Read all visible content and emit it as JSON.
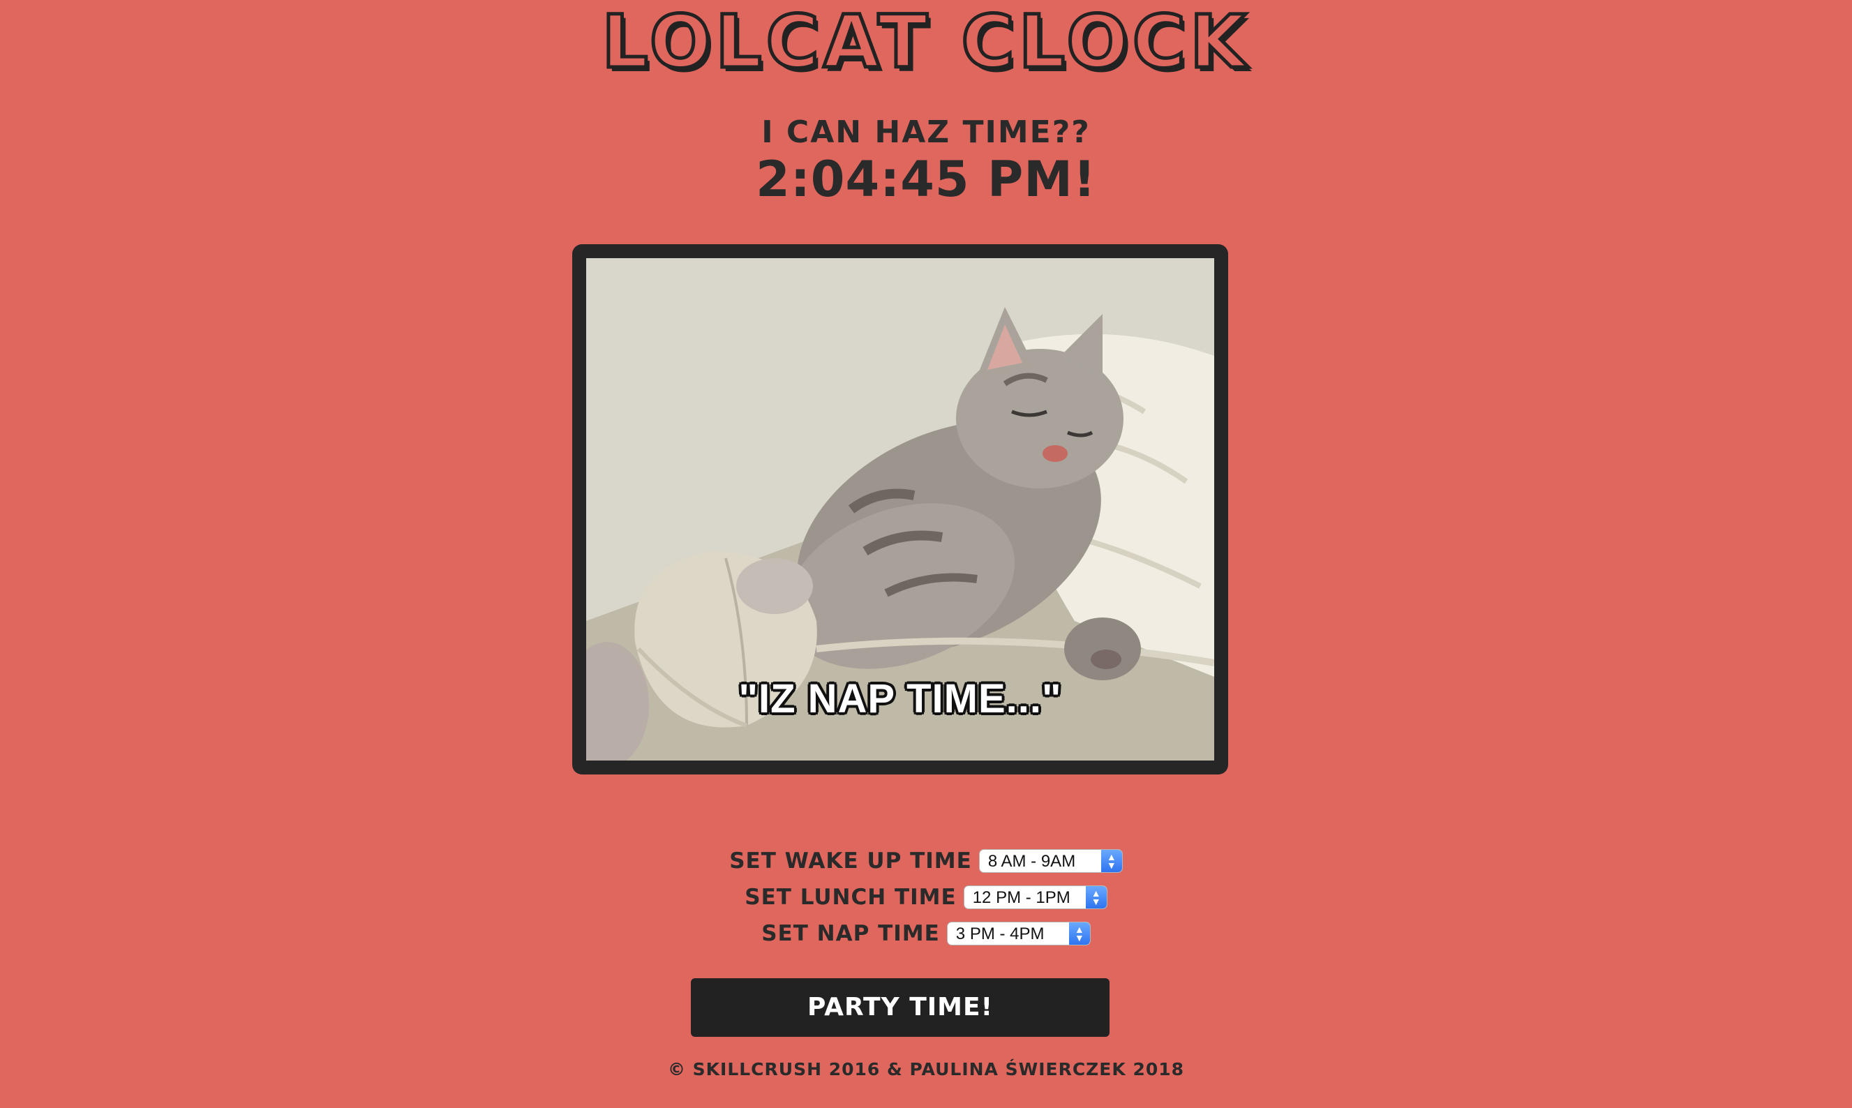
{
  "header": {
    "title": "LOLCAT CLOCK",
    "subtitle": "I CAN HAZ TIME??",
    "time": "2:04:45 PM!"
  },
  "image": {
    "caption": "\"IZ NAP TIME...\"",
    "subject": "sleeping-kitten-with-computer-mouse"
  },
  "controls": {
    "wake": {
      "label": "SET WAKE UP TIME",
      "value": "8 AM - 9AM"
    },
    "lunch": {
      "label": "SET LUNCH TIME",
      "value": "12 PM - 1PM"
    },
    "nap": {
      "label": "SET NAP TIME",
      "value": "3 PM - 4PM"
    }
  },
  "party_button": {
    "label": "PARTY TIME!"
  },
  "footer": {
    "text": "© SKILLCRUSH 2016 & PAULINA ŚWIERCZEK 2018"
  },
  "colors": {
    "background": "#e0675e",
    "dark": "#222222",
    "select_accent": "#2f74f0"
  }
}
